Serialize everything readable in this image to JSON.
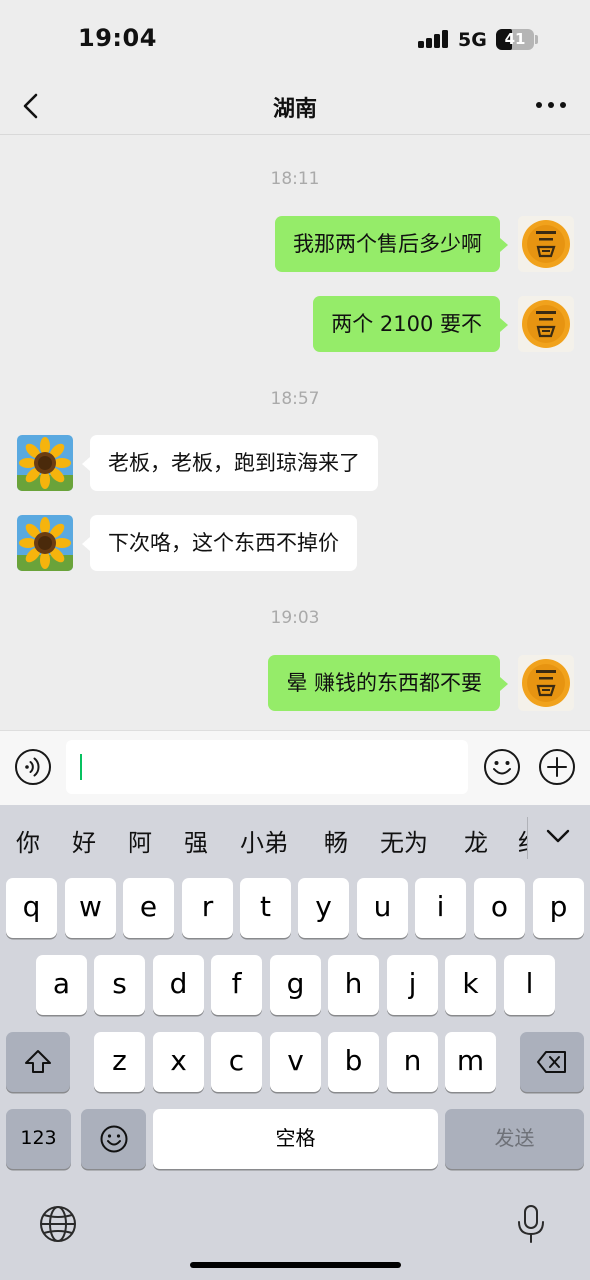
{
  "status_bar": {
    "time": "19:04",
    "network": "5G",
    "battery": "41"
  },
  "nav": {
    "title": "湖南"
  },
  "timestamps": [
    "18:11",
    "18:57",
    "19:03"
  ],
  "messages": [
    {
      "sender": "me",
      "text": "我那两个售后多少啊"
    },
    {
      "sender": "me",
      "text": "两个 2100 要不"
    },
    {
      "sender": "other",
      "text": "老板，老板，跑到琼海来了"
    },
    {
      "sender": "other",
      "text": "下次咯，这个东西不掉价"
    },
    {
      "sender": "me",
      "text": "晕 赚钱的东西都不要"
    }
  ],
  "input": {
    "value": ""
  },
  "keyboard": {
    "candidates": [
      "你",
      "好",
      "阿",
      "强",
      "小弟",
      "畅",
      "无为",
      "龙",
      "红"
    ],
    "row1": [
      "q",
      "w",
      "e",
      "r",
      "t",
      "y",
      "u",
      "i",
      "o",
      "p"
    ],
    "row2": [
      "a",
      "s",
      "d",
      "f",
      "g",
      "h",
      "j",
      "k",
      "l"
    ],
    "row3": [
      "z",
      "x",
      "c",
      "v",
      "b",
      "n",
      "m"
    ],
    "numbers_label": "123",
    "space_label": "空格",
    "send_label": "发送"
  },
  "icons": {
    "back": "chevron-left-icon",
    "more": "more-dots-icon",
    "voice": "voice-icon",
    "emoji": "emoji-icon",
    "plus": "plus-icon",
    "shift": "shift-icon",
    "delete": "backspace-icon",
    "globe": "globe-icon",
    "mic": "microphone-icon"
  },
  "colors": {
    "my_bubble": "#95ec69",
    "other_bubble": "#ffffff",
    "background": "#ededed",
    "cursor": "#07c160"
  }
}
